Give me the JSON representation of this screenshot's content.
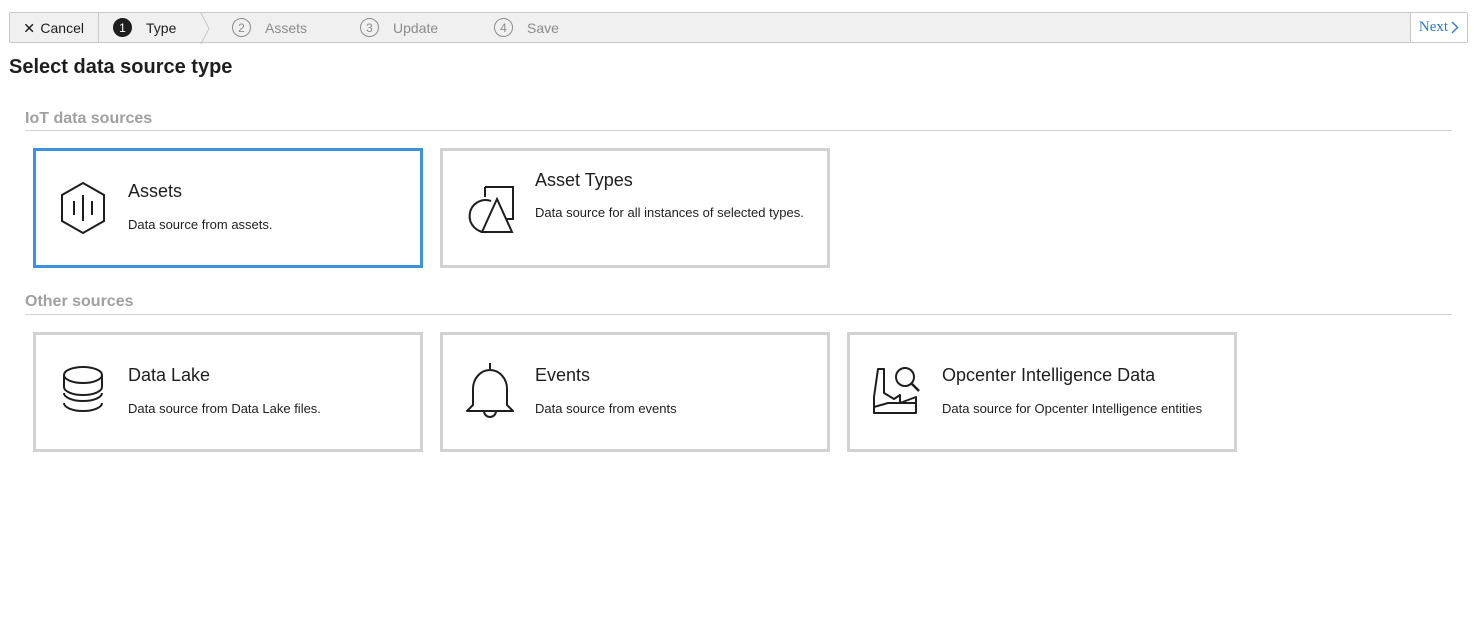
{
  "wizard": {
    "cancel_label": "Cancel",
    "steps": [
      {
        "num": "1",
        "label": "Type"
      },
      {
        "num": "2",
        "label": "Assets"
      },
      {
        "num": "3",
        "label": "Update"
      },
      {
        "num": "4",
        "label": "Save"
      }
    ],
    "next_label": "Next"
  },
  "page": {
    "title": "Select data source type"
  },
  "sections": {
    "iot": {
      "title": "IoT data sources",
      "cards": [
        {
          "title": "Assets",
          "desc": "Data source from assets.",
          "icon": "asset-hexagon-icon"
        },
        {
          "title": "Asset Types",
          "desc": "Data source for all instances of selected types.",
          "icon": "asset-types-shapes-icon"
        }
      ]
    },
    "other": {
      "title": "Other sources",
      "cards": [
        {
          "title": "Data Lake",
          "desc": "Data source from Data Lake files.",
          "icon": "database-icon"
        },
        {
          "title": "Events",
          "desc": "Data source from events",
          "icon": "bell-icon"
        },
        {
          "title": "Opcenter Intelligence Data",
          "desc": "Data source for Opcenter Intelligence entities",
          "icon": "factory-search-icon"
        }
      ]
    }
  },
  "colors": {
    "selected_border": "#3d92e0",
    "link": "#2d78c8",
    "section_title": "#a0a0a0"
  }
}
